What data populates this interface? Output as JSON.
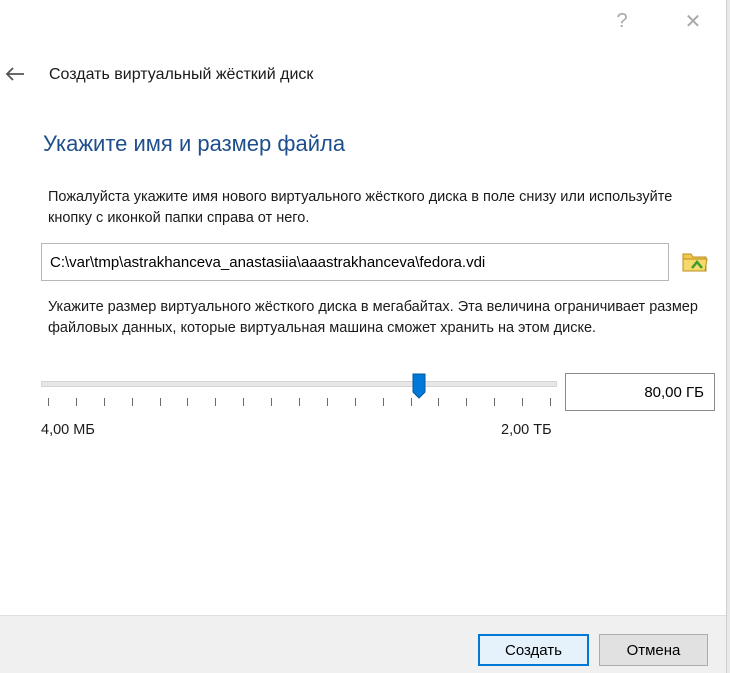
{
  "window": {
    "help_label": "?",
    "close_label": "✕"
  },
  "header": {
    "back_icon": "arrow-left-icon",
    "title": "Создать виртуальный жёсткий диск"
  },
  "page": {
    "section_title": "Укажите имя и размер файла",
    "file_description": "Пожалуйста укажите имя нового виртуального жёсткого диска в поле снизу или используйте кнопку с иконкой папки справа от него.",
    "file_path": "C:\\var\\tmp\\astrakhanceva_anastasiia\\aaastrakhanceva\\fedora.vdi",
    "folder_icon": "folder-icon",
    "size_description": "Укажите размер виртуального жёсткого диска в мегабайтах. Эта величина ограничивает размер файловых данных, которые виртуальная машина сможет хранить на этом диске.",
    "size_value": "80,00 ГБ",
    "slider": {
      "min_label": "4,00 МБ",
      "max_label": "2,00 ТБ",
      "position_fraction": 0.74,
      "tick_count": 19
    }
  },
  "footer": {
    "create_label": "Создать",
    "cancel_label": "Отмена"
  },
  "colors": {
    "accent": "#0078d7",
    "title_blue": "#1f4e8c",
    "footer_bg": "#f0f0f0"
  }
}
